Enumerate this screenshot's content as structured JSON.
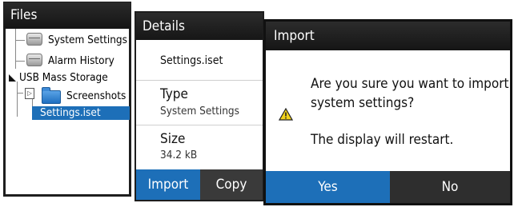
{
  "files": {
    "title": "Files",
    "items": [
      {
        "label": "System Settings"
      },
      {
        "label": "Alarm History"
      },
      {
        "label": "USB Mass Storage"
      },
      {
        "label": "Screenshots"
      },
      {
        "label": "Settings.iset"
      }
    ]
  },
  "details": {
    "title": "Details",
    "filename": "Settings.iset",
    "type_label": "Type",
    "type_value": "System Settings",
    "size_label": "Size",
    "size_value": "34.2 kB",
    "import_label": "Import",
    "copy_label": "Copy"
  },
  "dialog": {
    "title": "Import",
    "message_line1": "Are you sure you want to import",
    "message_line2": "system settings?",
    "message_line3": "The display will restart.",
    "yes_label": "Yes",
    "no_label": "No"
  },
  "colors": {
    "accent": "#1d6fb8",
    "header": "#1a1a1a",
    "warning": "#f2d21b"
  }
}
